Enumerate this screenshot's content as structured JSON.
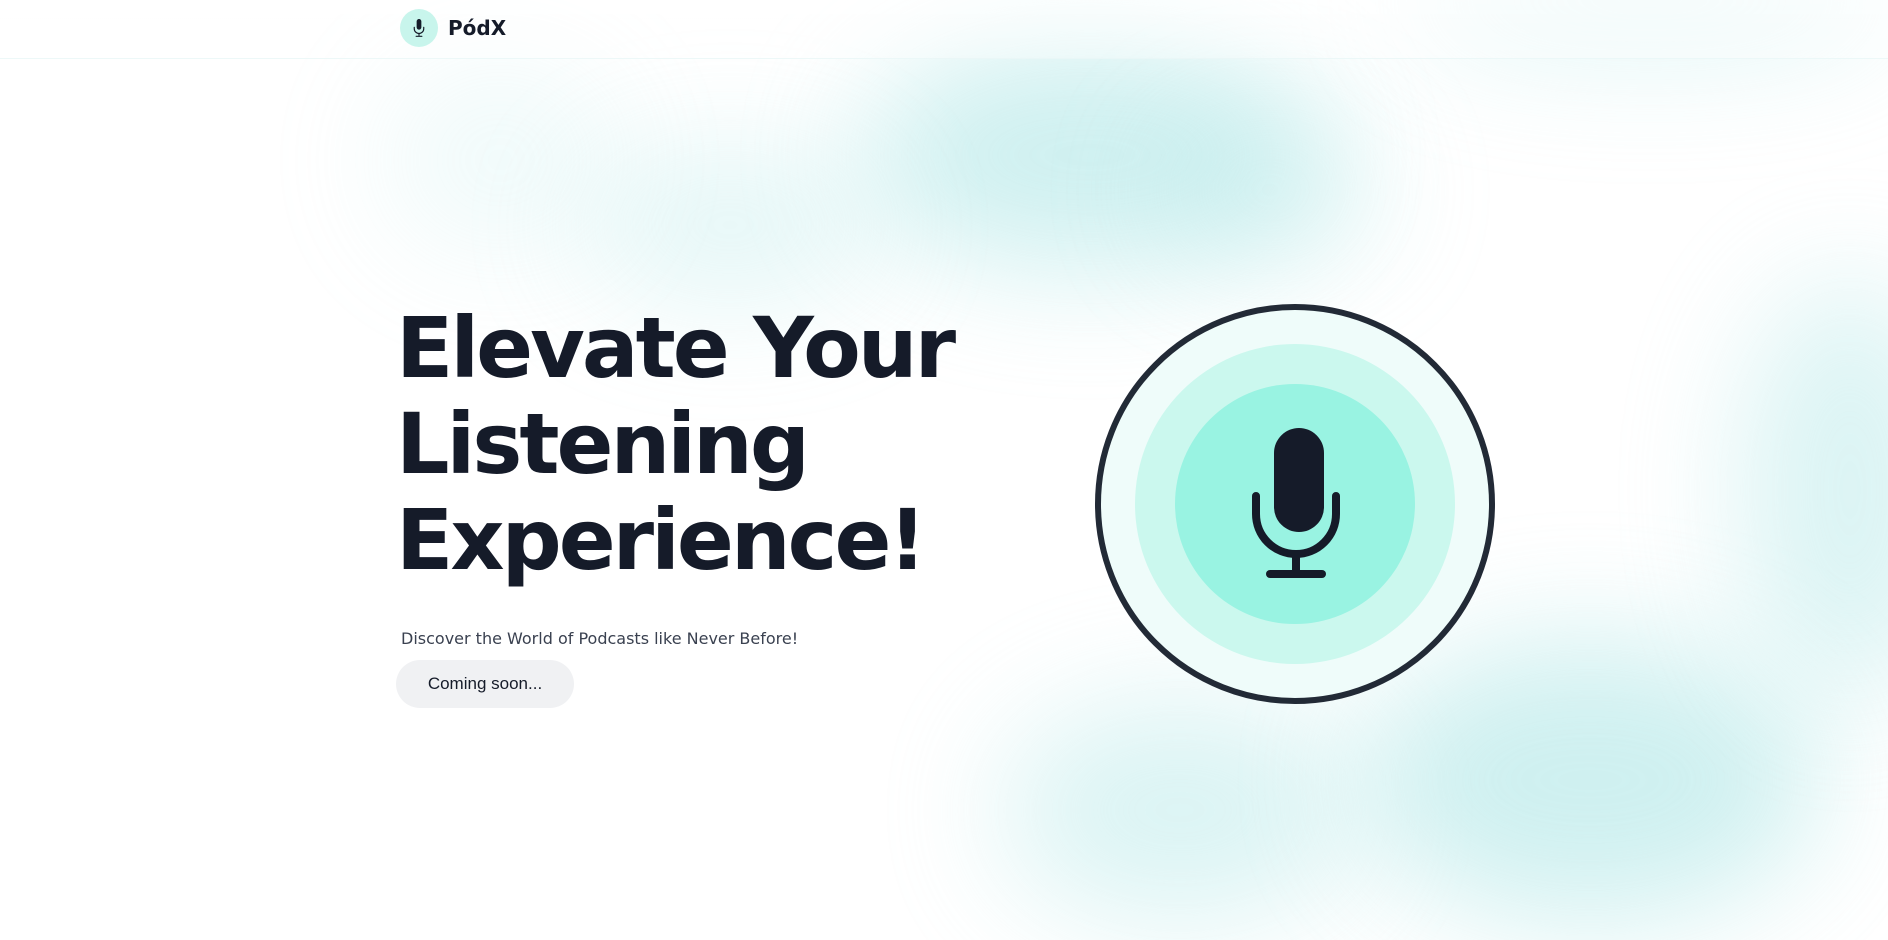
{
  "brand": {
    "name": "PódX",
    "icon": "microphone-icon"
  },
  "hero": {
    "title_lines": [
      "Elevate Your",
      "Listening",
      "Experience!"
    ],
    "subtitle": "Discover the World of Podcasts like Never Before!",
    "cta_label": "Coming soon...",
    "illustration_icon": "microphone-icon"
  },
  "colors": {
    "text_dark": "#151b29",
    "accent_teal": "#99f3e2",
    "accent_teal_light": "#cbf8ee",
    "ring_stroke": "#222a36",
    "button_bg": "#f0f1f3"
  }
}
